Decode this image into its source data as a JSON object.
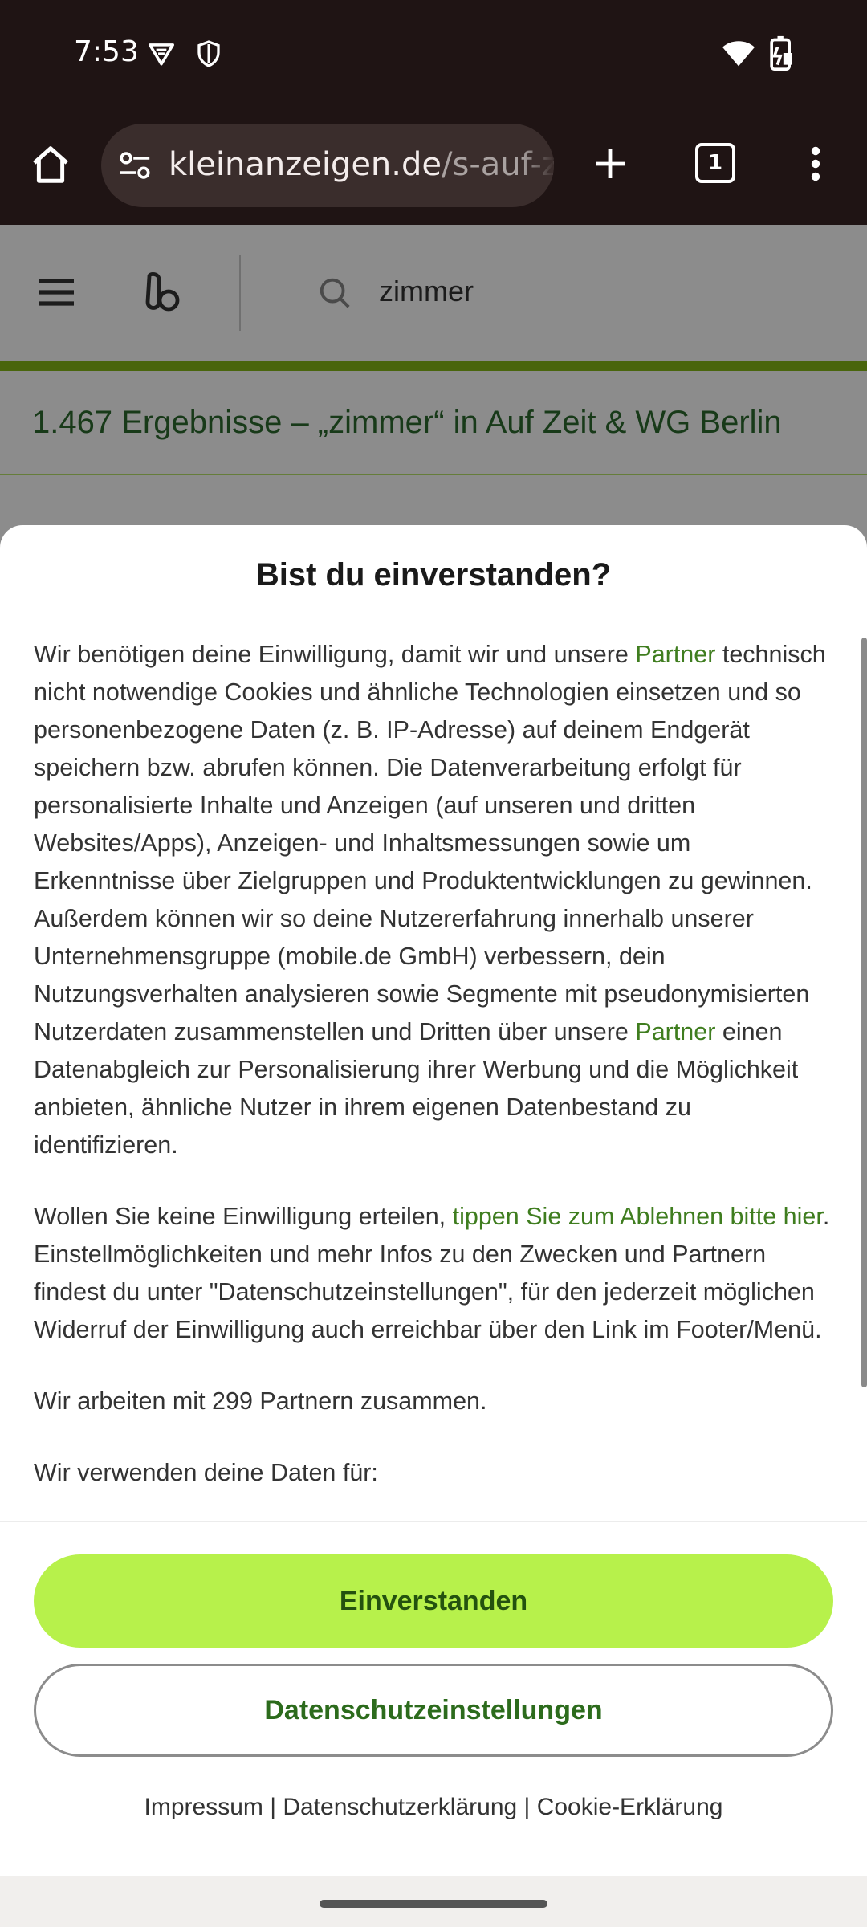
{
  "status_bar": {
    "time": "7:53",
    "left_icons": [
      "vpn-key-icon",
      "shield-icon"
    ],
    "right_icons": [
      "wifi-icon",
      "battery-icon"
    ]
  },
  "browser": {
    "url_domain": "kleinanzeigen.de",
    "url_path": "/s-auf-z",
    "tab_count": "1",
    "icons": [
      "home-icon",
      "site-settings-icon",
      "new-tab-icon",
      "tab-switcher-icon",
      "overflow-menu-icon"
    ]
  },
  "page": {
    "search_query": "zimmer",
    "results_heading": "1.467 Ergebnisse – „zimmer“ in Auf Zeit & WG Berlin",
    "accent": "#86b817"
  },
  "consent": {
    "title": "Bist du einverstanden?",
    "p1_a": "Wir benötigen deine Einwilligung, damit wir und unsere ",
    "p1_link1": "Partner",
    "p1_b": " technisch nicht notwendige Cookies und ähnliche Technologien einsetzen und so personenbezogene Daten (z. B. IP-Adresse) auf deinem Endgerät speichern bzw. abrufen können. Die Datenverarbeitung erfolgt für personalisierte Inhalte und Anzeigen (auf unseren und dritten Websites/Apps), Anzeigen- und Inhaltsmessungen sowie um Erkenntnisse über Zielgruppen und Produktentwicklungen zu gewinnen. Außerdem können wir so deine Nutzererfahrung innerhalb unserer Unternehmensgruppe (mobile.de GmbH) verbessern, dein Nutzungsverhalten analysieren sowie Segmente mit pseudonymisierten Nutzerdaten zusammenstellen und Dritten über unsere ",
    "p1_link2": "Partner",
    "p1_c": " einen Datenabgleich zur Personalisierung ihrer Werbung und die Möglichkeit anbieten, ähnliche Nutzer in ihrem eigenen Datenbestand zu identifizieren.",
    "p2_a": "Wollen Sie keine Einwilligung erteilen, ",
    "p2_link": "tippen Sie zum Ablehnen bitte hier",
    "p2_b": ". Einstellmöglichkeiten und mehr Infos zu den Zwecken und Partnern findest du unter \"Datenschutzeinstellungen\", für den jederzeit möglichen Widerruf der Einwilligung auch erreichbar über den Link im Footer/Menü.",
    "p3": "Wir arbeiten mit 299 Partnern zusammen.",
    "p4": "Wir verwenden deine Daten für:",
    "accept_label": "Einverstanden",
    "settings_label": "Datenschutzeinstellungen",
    "legal_impressum": "Impressum",
    "legal_privacy": "Datenschutzerklärung",
    "legal_cookie": "Cookie-Erklärung",
    "separator": "|",
    "accept_color": "#b7f14b",
    "link_color": "#3f7d1f"
  }
}
